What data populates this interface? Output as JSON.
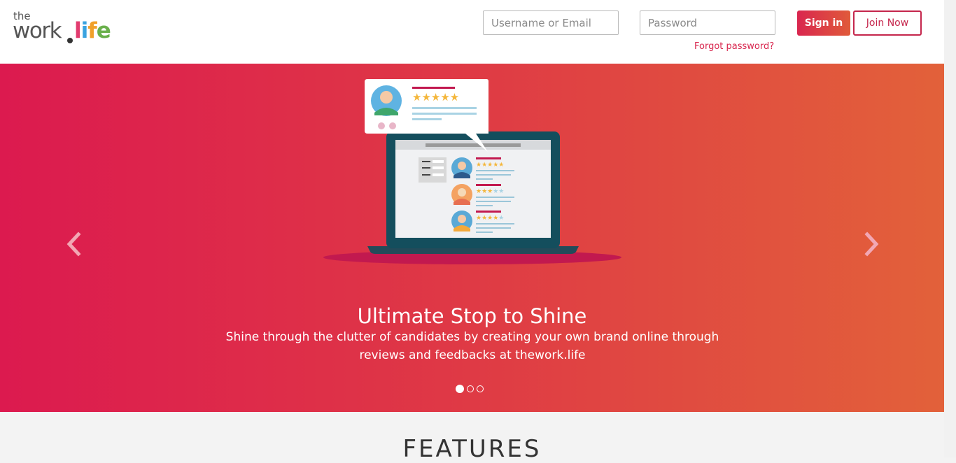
{
  "logo": {
    "top": "the",
    "work": "work",
    "life_letters": [
      "l",
      "i",
      "f",
      "e"
    ]
  },
  "login": {
    "username_placeholder": "Username or Email",
    "password_placeholder": "Password",
    "forgot_label": "Forgot password?",
    "signin_label": "Sign in",
    "join_label": "Join Now"
  },
  "hero": {
    "title": "Ultimate Stop to Shine",
    "subtitle": "Shine through the clutter of candidates by creating your own brand online through reviews and feedbacks at thework.life",
    "slides_count": 3,
    "active_slide": 1
  },
  "features": {
    "title": "FEATURES"
  },
  "colors": {
    "accent": "#d8254d",
    "hero_start": "#dc1a4f",
    "hero_end": "#e2613a"
  },
  "icons": [
    "chevron-left-icon",
    "chevron-right-icon"
  ]
}
